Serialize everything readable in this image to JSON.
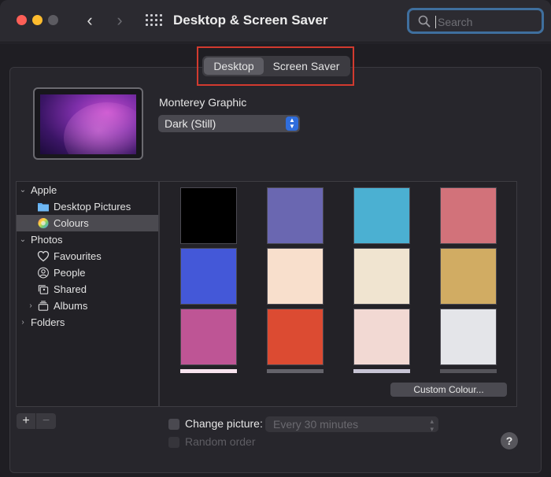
{
  "window": {
    "title": "Desktop & Screen Saver"
  },
  "search": {
    "placeholder": "Search"
  },
  "tabs": {
    "items": [
      {
        "label": "Desktop",
        "active": true
      },
      {
        "label": "Screen Saver",
        "active": false
      }
    ]
  },
  "wallpaper": {
    "name": "Monterey Graphic",
    "appearance_selected": "Dark (Still)"
  },
  "sidebar": {
    "items": [
      {
        "label": "Apple",
        "expanded": true
      },
      {
        "label": "Desktop Pictures"
      },
      {
        "label": "Colours",
        "selected": true
      },
      {
        "label": "Photos",
        "expanded": true
      },
      {
        "label": "Favourites"
      },
      {
        "label": "People"
      },
      {
        "label": "Shared"
      },
      {
        "label": "Albums",
        "expanded": false
      },
      {
        "label": "Folders",
        "expanded": false
      }
    ],
    "add_label": "+",
    "remove_label": "−"
  },
  "colours": {
    "swatches": [
      "#000000",
      "#6a67b1",
      "#4bb0d2",
      "#d2727a",
      "#4458d8",
      "#f8dfcc",
      "#f0e4d0",
      "#d1ac63",
      "#be5595",
      "#dc4b32",
      "#f2d9d3",
      "#e4e5e9"
    ],
    "partial_row": [
      "#f8e4ef",
      "#64636a",
      "#c7c4d4",
      "#55545a"
    ]
  },
  "custom_colour": {
    "label": "Custom Colour..."
  },
  "change_picture": {
    "label": "Change picture:",
    "interval": "Every 30 minutes",
    "checked": false
  },
  "random_order": {
    "label": "Random order",
    "checked": false
  },
  "help": {
    "label": "?"
  }
}
